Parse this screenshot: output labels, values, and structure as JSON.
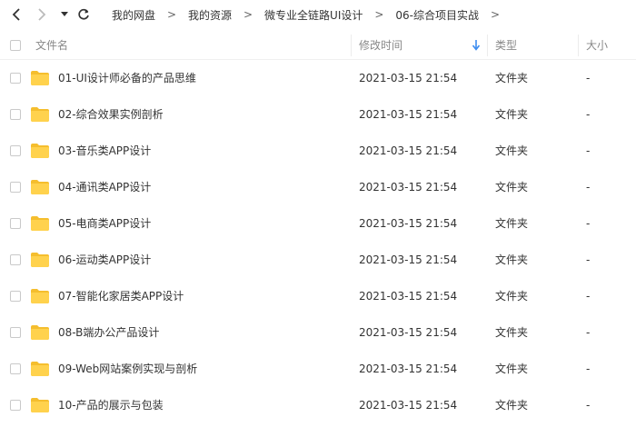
{
  "nav": {
    "back_icon": "chevron-left-icon",
    "forward_icon": "chevron-right-icon",
    "dropdown_icon": "caret-down-icon",
    "refresh_icon": "refresh-icon",
    "breadcrumbs": [
      "我的网盘",
      "我的资源",
      "微专业全链路UI设计",
      "06-综合项目实战"
    ],
    "separator": ">"
  },
  "header": {
    "name": "文件名",
    "modified": "修改时间",
    "type": "类型",
    "size": "大小",
    "sort_icon": "arrow-down-icon"
  },
  "colors": {
    "folder": "#FFD24D",
    "folder_back": "#F5BE2E",
    "sort_arrow": "#3B8CF0"
  },
  "files": [
    {
      "name": "01-UI设计师必备的产品思维",
      "modified": "2021-03-15 21:54",
      "type": "文件夹",
      "size": "-"
    },
    {
      "name": "02-综合效果实例剖析",
      "modified": "2021-03-15 21:54",
      "type": "文件夹",
      "size": "-"
    },
    {
      "name": "03-音乐类APP设计",
      "modified": "2021-03-15 21:54",
      "type": "文件夹",
      "size": "-"
    },
    {
      "name": "04-通讯类APP设计",
      "modified": "2021-03-15 21:54",
      "type": "文件夹",
      "size": "-"
    },
    {
      "name": "05-电商类APP设计",
      "modified": "2021-03-15 21:54",
      "type": "文件夹",
      "size": "-"
    },
    {
      "name": "06-运动类APP设计",
      "modified": "2021-03-15 21:54",
      "type": "文件夹",
      "size": "-"
    },
    {
      "name": "07-智能化家居类APP设计",
      "modified": "2021-03-15 21:54",
      "type": "文件夹",
      "size": "-"
    },
    {
      "name": "08-B端办公产品设计",
      "modified": "2021-03-15 21:54",
      "type": "文件夹",
      "size": "-"
    },
    {
      "name": "09-Web网站案例实现与剖析",
      "modified": "2021-03-15 21:54",
      "type": "文件夹",
      "size": "-"
    },
    {
      "name": "10-产品的展示与包装",
      "modified": "2021-03-15 21:54",
      "type": "文件夹",
      "size": "-"
    }
  ]
}
